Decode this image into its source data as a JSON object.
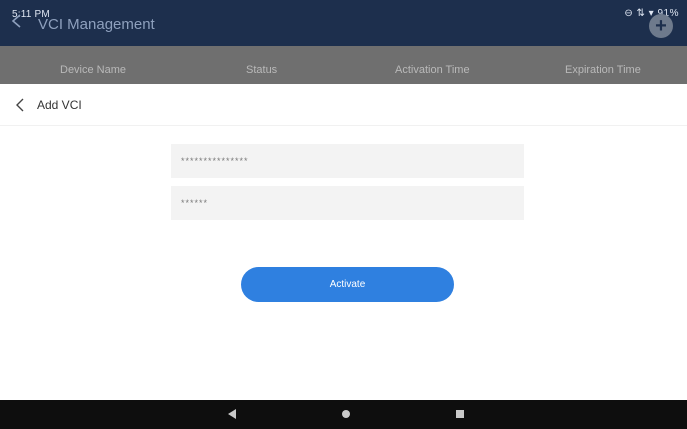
{
  "status_bar": {
    "time": "5:11 PM",
    "icons": "⊖ ⇅ ▾ 91%"
  },
  "background_page": {
    "title": "VCI Management",
    "columns": [
      "Device Name",
      "Status",
      "Activation Time",
      "Expiration Time"
    ],
    "add_icon": "plus-icon"
  },
  "dialog": {
    "title": "Add VCI",
    "serial_value": "***************",
    "code_value": "******",
    "activate_label": "Activate"
  },
  "nav_bar": {
    "buttons": [
      "back",
      "home",
      "recents"
    ]
  },
  "colors": {
    "header": "#1d2f4d",
    "primary": "#2f80e0",
    "field_bg": "#f3f3f3"
  }
}
